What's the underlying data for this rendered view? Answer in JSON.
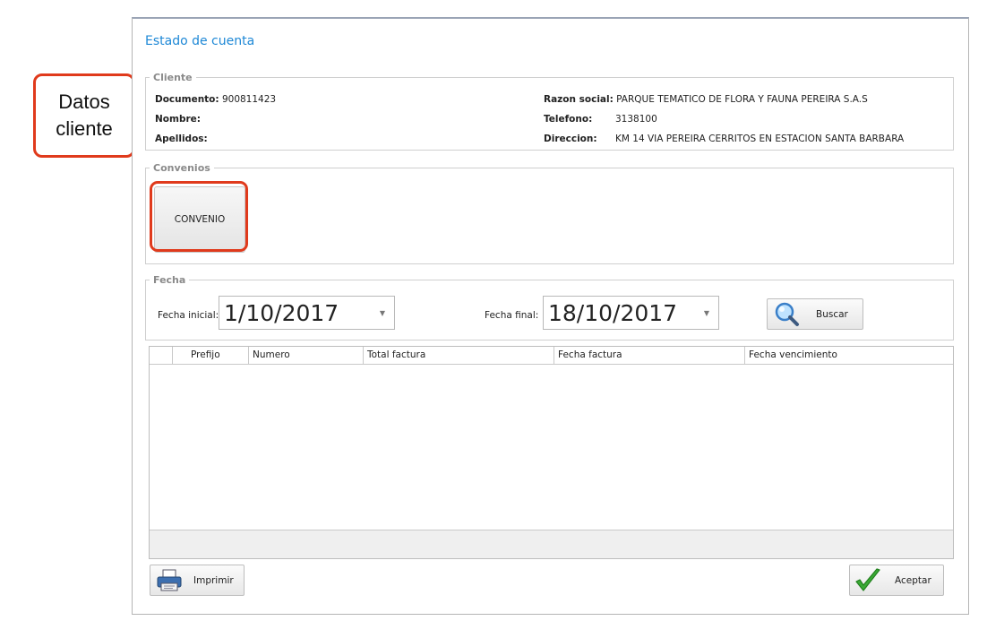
{
  "window": {
    "title": "Estado de cuenta"
  },
  "cliente": {
    "legend": "Cliente",
    "documento_label": "Documento:",
    "documento_value": "900811423",
    "nombre_label": "Nombre:",
    "apellidos_label": "Apellidos:",
    "razon_label": "Razon social:",
    "razon_value": "PARQUE TEMATICO DE FLORA Y FAUNA PEREIRA S.A.S",
    "telefono_label": "Telefono:",
    "telefono_value": "3138100",
    "direccion_label": "Direccion:",
    "direccion_value": "KM 14 VIA PEREIRA CERRITOS EN ESTACION SANTA BARBARA"
  },
  "convenios": {
    "legend": "Convenios",
    "button_label": "CONVENIO"
  },
  "fecha": {
    "legend": "Fecha",
    "inicial_label": "Fecha inicial:",
    "inicial_value": "1/10/2017",
    "final_label": "Fecha final:",
    "final_value": "18/10/2017",
    "buscar_label": "Buscar"
  },
  "grid": {
    "columns": [
      "Prefijo",
      "Numero",
      "Total factura",
      "Fecha factura",
      "Fecha vencimiento"
    ]
  },
  "footer": {
    "imprimir_label": "Imprimir",
    "aceptar_label": "Aceptar"
  },
  "annotation": {
    "line1": "Datos",
    "line2": "cliente",
    "color": "#e03a1c"
  },
  "colors": {
    "title": "#1e88d6",
    "accent_check": "#3aaa35"
  }
}
